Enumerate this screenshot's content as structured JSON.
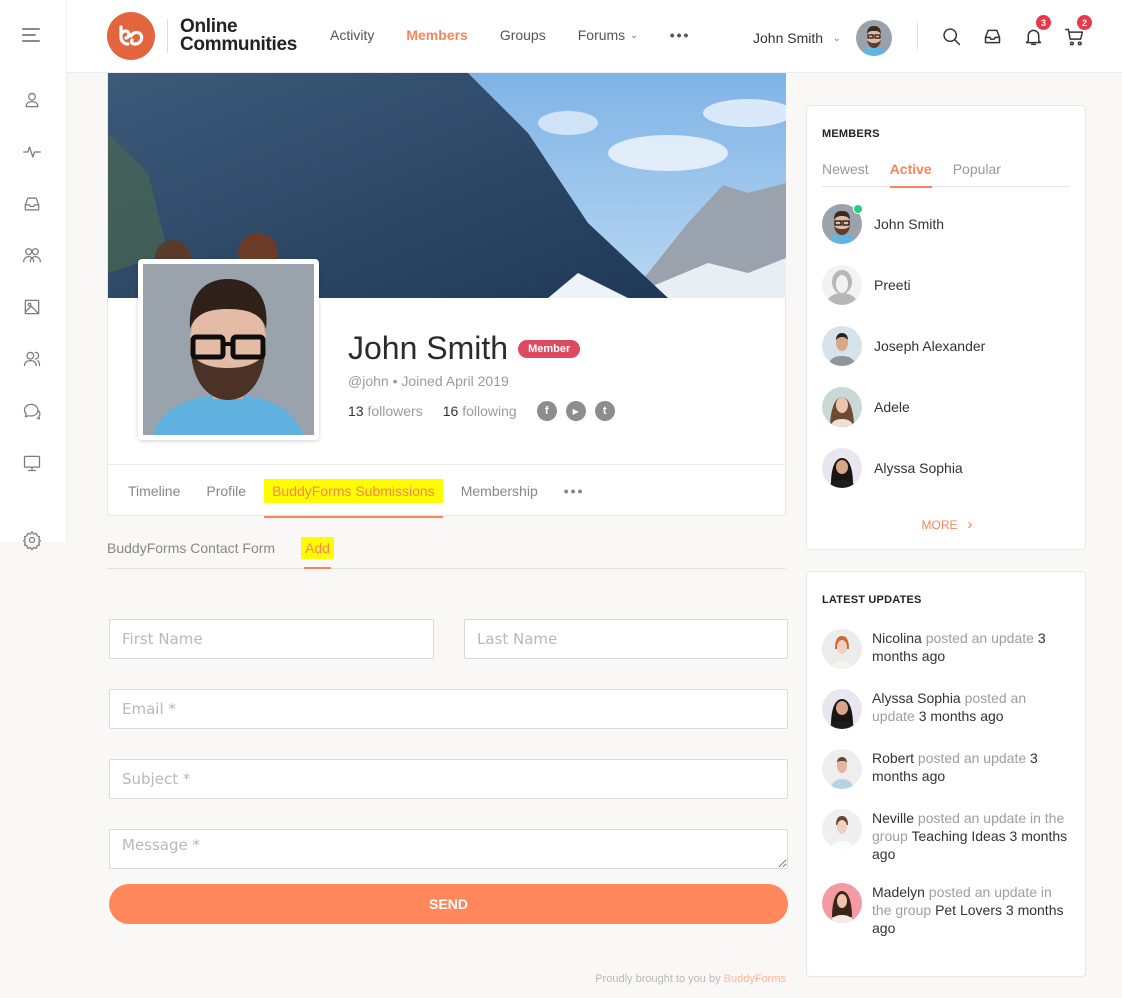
{
  "header": {
    "brand_line1": "Online",
    "brand_line2": "Communities",
    "nav": [
      {
        "label": "Activity",
        "active": false
      },
      {
        "label": "Members",
        "active": true
      },
      {
        "label": "Groups",
        "active": false
      },
      {
        "label": "Forums",
        "active": false,
        "has_dropdown": true
      }
    ],
    "nav_more": "•••",
    "user_name": "John Smith",
    "notifications_count": "3",
    "cart_count": "2",
    "icons": [
      "menu-icon",
      "search-icon",
      "inbox-icon",
      "bell-icon",
      "cart-icon"
    ]
  },
  "sidebar": {
    "icons": [
      "profile-icon",
      "activity-icon",
      "inbox-icon",
      "groups-icon",
      "photos-icon",
      "friends-icon",
      "forums-icon",
      "courses-icon",
      "settings-icon"
    ]
  },
  "profile": {
    "name": "John Smith",
    "badge": "Member",
    "handle_joined": "@john • Joined April 2019",
    "followers_count": "13",
    "followers_label": "followers",
    "following_count": "16",
    "following_label": "following",
    "social": [
      "f",
      "▶",
      "t"
    ],
    "tabs": [
      {
        "label": "Timeline",
        "active": false
      },
      {
        "label": "Profile",
        "active": false
      },
      {
        "label": "BuddyForms Submissions",
        "active": true
      },
      {
        "label": "Membership",
        "active": false
      }
    ],
    "tabs_more": "•••"
  },
  "subtabs": [
    {
      "label": "BuddyForms Contact Form",
      "active": false
    },
    {
      "label": "Add",
      "active": true
    }
  ],
  "form": {
    "first_name_placeholder": "First Name",
    "last_name_placeholder": "Last Name",
    "email_placeholder": "Email *",
    "subject_placeholder": "Subject *",
    "message_placeholder": "Message *",
    "send_label": "SEND",
    "credit_prefix": "Proudly brought to you by ",
    "credit_link": "BuddyForms"
  },
  "members_widget": {
    "title": "MEMBERS",
    "tabs": [
      {
        "label": "Newest",
        "active": false
      },
      {
        "label": "Active",
        "active": true
      },
      {
        "label": "Popular",
        "active": false
      }
    ],
    "members": [
      {
        "name": "John Smith",
        "online": true
      },
      {
        "name": "Preeti",
        "online": false
      },
      {
        "name": "Joseph Alexander",
        "online": false
      },
      {
        "name": "Adele",
        "online": false
      },
      {
        "name": "Alyssa Sophia",
        "online": false
      }
    ],
    "more_label": "MORE",
    "more_icon": "›"
  },
  "updates_widget": {
    "title": "LATEST UPDATES",
    "updates": [
      {
        "user": "Nicolina",
        "action": " posted an update ",
        "group": "",
        "time": "3 months ago"
      },
      {
        "user": "Alyssa Sophia",
        "action": " posted an update ",
        "group": "",
        "time": "3 months ago"
      },
      {
        "user": "Robert",
        "action": " posted an update ",
        "group": "",
        "time": "3 months ago"
      },
      {
        "user": "Neville",
        "action": " posted an update in the group ",
        "group": "Teaching Ideas",
        "time": " 3 months ago"
      },
      {
        "user": "Madelyn",
        "action": " posted an update in the group ",
        "group": "Pet Lovers",
        "time": " 3 months ago"
      }
    ]
  },
  "colors": {
    "accent": "#f7845a",
    "button": "#ff875a",
    "badge_red": "#e7394a",
    "member_badge": "#dd4a5f",
    "online": "#21d17d",
    "highlight": "#fffc00"
  }
}
